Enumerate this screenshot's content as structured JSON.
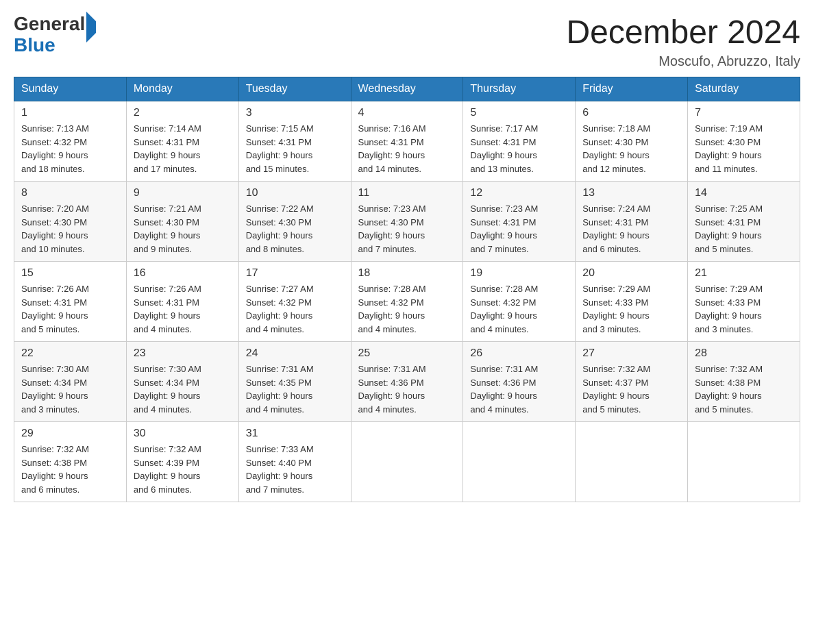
{
  "header": {
    "logo_general": "General",
    "logo_blue": "Blue",
    "title": "December 2024",
    "location": "Moscufo, Abruzzo, Italy"
  },
  "days_of_week": [
    "Sunday",
    "Monday",
    "Tuesday",
    "Wednesday",
    "Thursday",
    "Friday",
    "Saturday"
  ],
  "weeks": [
    [
      {
        "num": "1",
        "sunrise": "7:13 AM",
        "sunset": "4:32 PM",
        "daylight": "9 hours and 18 minutes."
      },
      {
        "num": "2",
        "sunrise": "7:14 AM",
        "sunset": "4:31 PM",
        "daylight": "9 hours and 17 minutes."
      },
      {
        "num": "3",
        "sunrise": "7:15 AM",
        "sunset": "4:31 PM",
        "daylight": "9 hours and 15 minutes."
      },
      {
        "num": "4",
        "sunrise": "7:16 AM",
        "sunset": "4:31 PM",
        "daylight": "9 hours and 14 minutes."
      },
      {
        "num": "5",
        "sunrise": "7:17 AM",
        "sunset": "4:31 PM",
        "daylight": "9 hours and 13 minutes."
      },
      {
        "num": "6",
        "sunrise": "7:18 AM",
        "sunset": "4:30 PM",
        "daylight": "9 hours and 12 minutes."
      },
      {
        "num": "7",
        "sunrise": "7:19 AM",
        "sunset": "4:30 PM",
        "daylight": "9 hours and 11 minutes."
      }
    ],
    [
      {
        "num": "8",
        "sunrise": "7:20 AM",
        "sunset": "4:30 PM",
        "daylight": "9 hours and 10 minutes."
      },
      {
        "num": "9",
        "sunrise": "7:21 AM",
        "sunset": "4:30 PM",
        "daylight": "9 hours and 9 minutes."
      },
      {
        "num": "10",
        "sunrise": "7:22 AM",
        "sunset": "4:30 PM",
        "daylight": "9 hours and 8 minutes."
      },
      {
        "num": "11",
        "sunrise": "7:23 AM",
        "sunset": "4:30 PM",
        "daylight": "9 hours and 7 minutes."
      },
      {
        "num": "12",
        "sunrise": "7:23 AM",
        "sunset": "4:31 PM",
        "daylight": "9 hours and 7 minutes."
      },
      {
        "num": "13",
        "sunrise": "7:24 AM",
        "sunset": "4:31 PM",
        "daylight": "9 hours and 6 minutes."
      },
      {
        "num": "14",
        "sunrise": "7:25 AM",
        "sunset": "4:31 PM",
        "daylight": "9 hours and 5 minutes."
      }
    ],
    [
      {
        "num": "15",
        "sunrise": "7:26 AM",
        "sunset": "4:31 PM",
        "daylight": "9 hours and 5 minutes."
      },
      {
        "num": "16",
        "sunrise": "7:26 AM",
        "sunset": "4:31 PM",
        "daylight": "9 hours and 4 minutes."
      },
      {
        "num": "17",
        "sunrise": "7:27 AM",
        "sunset": "4:32 PM",
        "daylight": "9 hours and 4 minutes."
      },
      {
        "num": "18",
        "sunrise": "7:28 AM",
        "sunset": "4:32 PM",
        "daylight": "9 hours and 4 minutes."
      },
      {
        "num": "19",
        "sunrise": "7:28 AM",
        "sunset": "4:32 PM",
        "daylight": "9 hours and 4 minutes."
      },
      {
        "num": "20",
        "sunrise": "7:29 AM",
        "sunset": "4:33 PM",
        "daylight": "9 hours and 3 minutes."
      },
      {
        "num": "21",
        "sunrise": "7:29 AM",
        "sunset": "4:33 PM",
        "daylight": "9 hours and 3 minutes."
      }
    ],
    [
      {
        "num": "22",
        "sunrise": "7:30 AM",
        "sunset": "4:34 PM",
        "daylight": "9 hours and 3 minutes."
      },
      {
        "num": "23",
        "sunrise": "7:30 AM",
        "sunset": "4:34 PM",
        "daylight": "9 hours and 4 minutes."
      },
      {
        "num": "24",
        "sunrise": "7:31 AM",
        "sunset": "4:35 PM",
        "daylight": "9 hours and 4 minutes."
      },
      {
        "num": "25",
        "sunrise": "7:31 AM",
        "sunset": "4:36 PM",
        "daylight": "9 hours and 4 minutes."
      },
      {
        "num": "26",
        "sunrise": "7:31 AM",
        "sunset": "4:36 PM",
        "daylight": "9 hours and 4 minutes."
      },
      {
        "num": "27",
        "sunrise": "7:32 AM",
        "sunset": "4:37 PM",
        "daylight": "9 hours and 5 minutes."
      },
      {
        "num": "28",
        "sunrise": "7:32 AM",
        "sunset": "4:38 PM",
        "daylight": "9 hours and 5 minutes."
      }
    ],
    [
      {
        "num": "29",
        "sunrise": "7:32 AM",
        "sunset": "4:38 PM",
        "daylight": "9 hours and 6 minutes."
      },
      {
        "num": "30",
        "sunrise": "7:32 AM",
        "sunset": "4:39 PM",
        "daylight": "9 hours and 6 minutes."
      },
      {
        "num": "31",
        "sunrise": "7:33 AM",
        "sunset": "4:40 PM",
        "daylight": "9 hours and 7 minutes."
      },
      null,
      null,
      null,
      null
    ]
  ],
  "labels": {
    "sunrise": "Sunrise:",
    "sunset": "Sunset:",
    "daylight": "Daylight:"
  }
}
